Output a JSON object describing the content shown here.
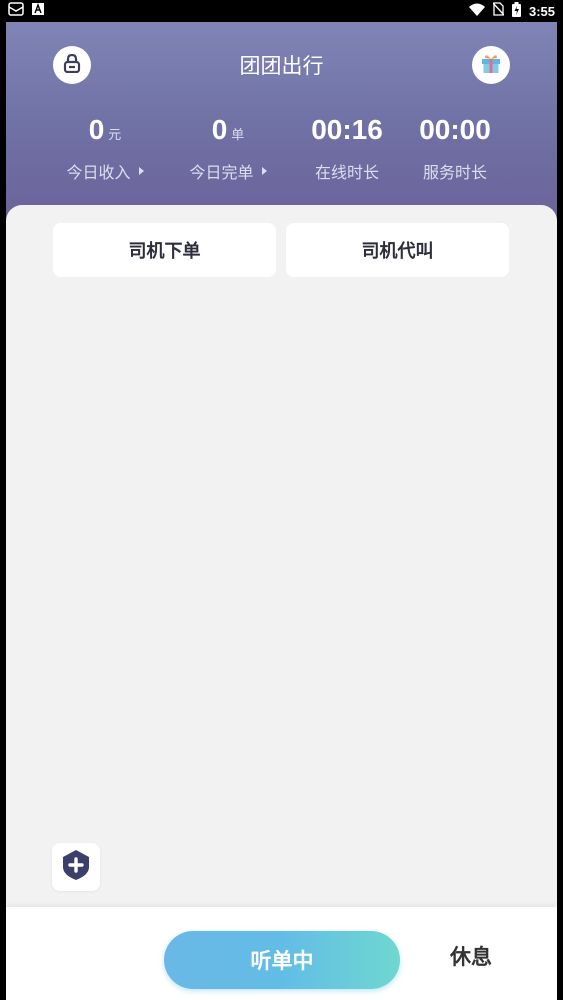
{
  "status_bar": {
    "time": "3:55"
  },
  "header": {
    "title": "团团出行",
    "left_icon": "lock-icon",
    "right_icon": "gift-icon"
  },
  "stats": [
    {
      "value": "0",
      "unit": "元",
      "label": "今日收入",
      "has_caret": true
    },
    {
      "value": "0",
      "unit": "单",
      "label": "今日完单",
      "has_caret": true
    },
    {
      "value": "00:16",
      "unit": "",
      "label": "在线时长",
      "has_caret": false
    },
    {
      "value": "00:00",
      "unit": "",
      "label": "服务时长",
      "has_caret": false
    }
  ],
  "actions": {
    "driver_order": "司机下单",
    "driver_call": "司机代叫"
  },
  "shield_icon": "shield-plus-icon",
  "bottom": {
    "listening": "听单中",
    "rest": "休息"
  },
  "colors": {
    "header": "#6f70a4",
    "listen_button": "#62bde6",
    "background": "#f2f2f2"
  }
}
